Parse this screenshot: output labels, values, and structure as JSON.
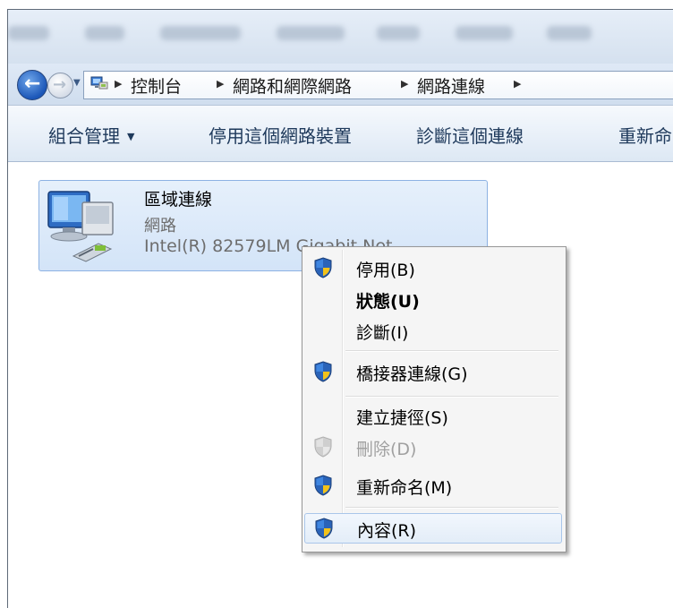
{
  "address": {
    "crumbs": [
      "控制台",
      "網路和網際網路",
      "網路連線"
    ]
  },
  "command_bar": {
    "organize": "組合管理",
    "disable_device": "停用這個網路裝置",
    "diagnose": "診斷這個連線",
    "rename": "重新命"
  },
  "item": {
    "name": "區域連線",
    "type": "網路",
    "device": "Intel(R) 82579LM Gigabit Net"
  },
  "menu": {
    "items": [
      {
        "label": "停用(B)",
        "shield": true
      },
      {
        "label": "狀態(U)",
        "bold": true
      },
      {
        "label": "診斷(I)"
      },
      {
        "label": "橋接器連線(G)",
        "shield": true
      },
      {
        "label": "建立捷徑(S)"
      },
      {
        "label": "刪除(D)",
        "shield": true,
        "disabled": true
      },
      {
        "label": "重新命名(M)",
        "shield": true
      },
      {
        "label": "內容(R)",
        "shield": true,
        "hover": true
      }
    ]
  },
  "colors": {
    "accent_blue": "#1c57b8",
    "command_text": "#1e395b",
    "selection_bg": "#d3e4f8",
    "shield_blue": "#2a63b8",
    "shield_yellow": "#f2c21a"
  }
}
